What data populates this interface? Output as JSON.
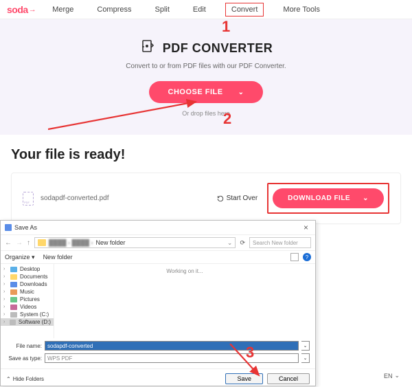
{
  "logo": "soda",
  "nav": {
    "items": [
      "Merge",
      "Compress",
      "Split",
      "Edit",
      "Convert",
      "More Tools"
    ],
    "highlighted_index": 4
  },
  "hero": {
    "title": "PDF CONVERTER",
    "subtitle": "Convert to or from PDF files with our PDF Converter.",
    "choose_label": "CHOOSE FILE",
    "drop_label": "Or drop files here"
  },
  "ready": {
    "title": "Your file is ready!",
    "filename": "sodapdf-converted.pdf",
    "startover_label": "Start Over",
    "download_label": "DOWNLOAD FILE"
  },
  "dialog": {
    "title": "Save As",
    "breadcrumb_last": "New folder",
    "search_placeholder": "Search New folder",
    "organize_label": "Organize",
    "newfolder_label": "New folder",
    "tree": [
      "Desktop",
      "Documents",
      "Downloads",
      "Music",
      "Pictures",
      "Videos",
      "System (C:)",
      "Software (D:)"
    ],
    "working": "Working on it...",
    "filename_label": "File name:",
    "filename_value": "sodapdf-converted",
    "savetype_label": "Save as type:",
    "savetype_value": "WPS PDF",
    "hide_folders": "Hide Folders",
    "save": "Save",
    "cancel": "Cancel"
  },
  "lang": "EN",
  "annotations": {
    "one": "1",
    "two": "2",
    "three": "3"
  }
}
